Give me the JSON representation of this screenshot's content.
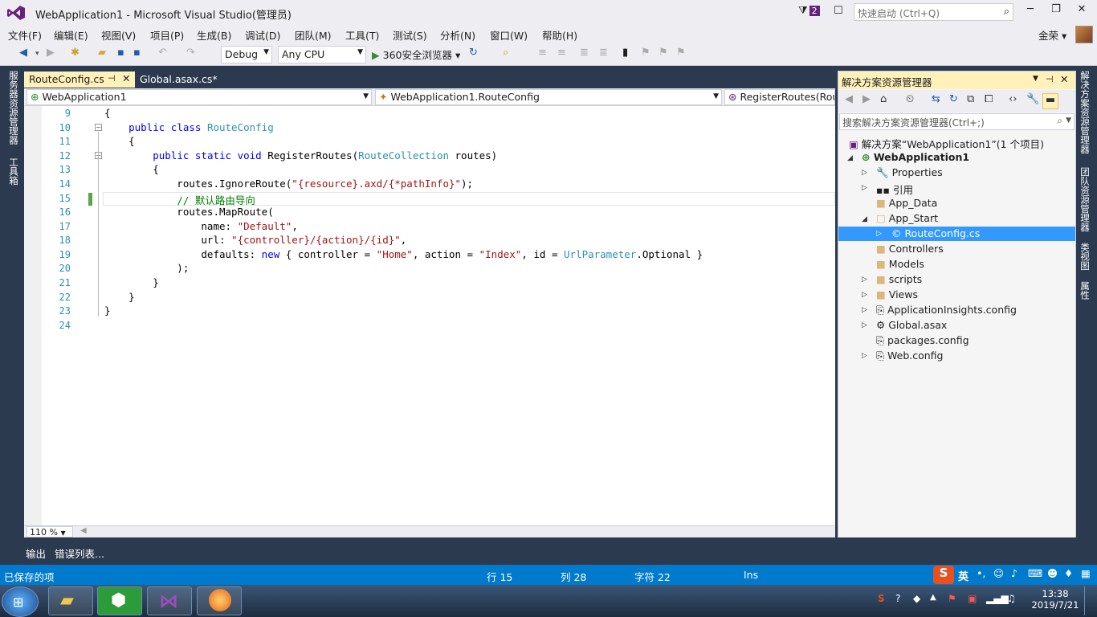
{
  "window": {
    "title": "WebApplication1 - Microsoft Visual Studio(管理员)",
    "notification_count": "2",
    "quick_launch_placeholder": "快速启动 (Ctrl+Q)",
    "controls": [
      "─",
      "❐",
      "✕"
    ]
  },
  "menu": [
    "文件(F)",
    "编辑(E)",
    "视图(V)",
    "项目(P)",
    "生成(B)",
    "调试(D)",
    "团队(M)",
    "工具(T)",
    "测试(S)",
    "分析(N)",
    "窗口(W)",
    "帮助(H)"
  ],
  "user": "金荣",
  "toolbar": {
    "config": "Debug",
    "platform": "Any CPU",
    "run_label": "360安全浏览器"
  },
  "left_panel": [
    "服务器资源管理器",
    "工具箱"
  ],
  "right_panel": [
    "解决方案资源管理器",
    "团队资源管理器",
    "类视图",
    "属性"
  ],
  "tabs": [
    {
      "label": "RouteConfig.cs",
      "active": true
    },
    {
      "label": "Global.asax.cs*",
      "active": false
    }
  ],
  "nav": {
    "project": "WebApplication1",
    "class": "WebApplication1.RouteConfig",
    "member": "RegisterRoutes(Rout"
  },
  "line_numbers": [
    "9",
    "10",
    "11",
    "12",
    "13",
    "14",
    "15",
    "16",
    "17",
    "18",
    "19",
    "20",
    "21",
    "22",
    "23",
    "24"
  ],
  "zoom": "110 %",
  "solution_explorer": {
    "title": "解决方案资源管理器",
    "search_placeholder": "搜索解决方案资源管理器(Ctrl+;)",
    "items": [
      {
        "label": "解决方案“WebApplication1”(1 个项目)"
      },
      {
        "label": "WebApplication1"
      },
      {
        "label": "Properties"
      },
      {
        "label": "引用"
      },
      {
        "label": "App_Data"
      },
      {
        "label": "App_Start"
      },
      {
        "label": "RouteConfig.cs"
      },
      {
        "label": "Controllers"
      },
      {
        "label": "Models"
      },
      {
        "label": "scripts"
      },
      {
        "label": "Views"
      },
      {
        "label": "ApplicationInsights.config"
      },
      {
        "label": "Global.asax"
      },
      {
        "label": "packages.config"
      },
      {
        "label": "Web.config"
      }
    ]
  },
  "bottom_tabs": [
    "输出",
    "错误列表..."
  ],
  "status": {
    "message": "已保存的项",
    "line": "行 15",
    "col": "列 28",
    "char": "字符 22",
    "mode": "Ins"
  },
  "ime": "英",
  "clock": {
    "time": "13:38",
    "date": "2019/7/21"
  }
}
